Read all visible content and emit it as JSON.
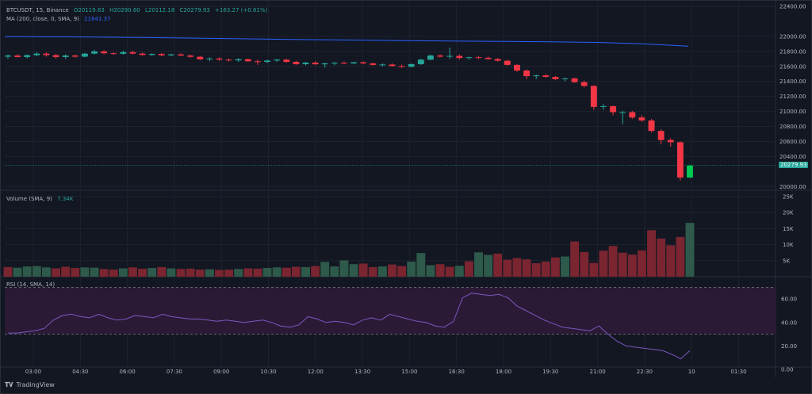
{
  "header": {
    "symbol": "BTCUSDT, 15, Binance",
    "o": "O20119.83",
    "h": "H20290.60",
    "l": "L20112.18",
    "c": "C20279.93",
    "chg": "+163.27 (+0.81%)",
    "ma_label": "MA (200, close, 0, SMA, 9)",
    "ma_value": "21841.37"
  },
  "volume_legend": {
    "label": "Volume (SMA, 9)",
    "value": "7.34K"
  },
  "rsi_legend": {
    "label": "RSI (14, SMA, 14)"
  },
  "last_price_label": "20279.93",
  "brand": "TradingView",
  "colors": {
    "bg": "#131722",
    "up": "#26a69a",
    "down": "#f23645",
    "up_bright": "#00c853",
    "ma": "#2962ff",
    "grid": "#1e222d",
    "axis_text": "#b2b5be",
    "vol_up": "#2e5a4b",
    "vol_down": "#7a2530",
    "rsi": "#7e57c2",
    "rsi_band": "#2a1a35"
  },
  "chart_data": [
    {
      "type": "candlestick",
      "title": "BTCUSDT, 15, Binance",
      "ylim": [
        19950,
        22400
      ],
      "price_ticks": [
        "22400.00",
        "22000.00",
        "21800.00",
        "21600.00",
        "21400.00",
        "21200.00",
        "21000.00",
        "20800.00",
        "20600.00",
        "20400.00",
        "20279.93",
        "20000.00"
      ],
      "time_ticks": [
        "03:00",
        "04:30",
        "06:00",
        "07:30",
        "09:00",
        "10:30",
        "12:00",
        "13:30",
        "15:00",
        "16:30",
        "18:00",
        "19:30",
        "21:00",
        "22:30",
        "10",
        "01:30"
      ],
      "ma_series": [
        21998,
        21995,
        21990,
        21985,
        21978,
        21970,
        21962,
        21955,
        21948,
        21942,
        21936,
        21932,
        21928,
        21920,
        21900,
        21870
      ],
      "candles": [
        [
          21730,
          21760,
          21700,
          21745
        ],
        [
          21745,
          21765,
          21720,
          21725
        ],
        [
          21725,
          21760,
          21705,
          21750
        ],
        [
          21750,
          21790,
          21735,
          21770
        ],
        [
          21770,
          21790,
          21730,
          21750
        ],
        [
          21750,
          21770,
          21705,
          21725
        ],
        [
          21725,
          21760,
          21700,
          21745
        ],
        [
          21745,
          21760,
          21715,
          21730
        ],
        [
          21730,
          21780,
          21720,
          21770
        ],
        [
          21770,
          21820,
          21760,
          21800
        ],
        [
          21800,
          21815,
          21760,
          21775
        ],
        [
          21775,
          21790,
          21755,
          21768
        ],
        [
          21768,
          21810,
          21755,
          21790
        ],
        [
          21790,
          21805,
          21760,
          21770
        ],
        [
          21770,
          21785,
          21745,
          21752
        ],
        [
          21752,
          21775,
          21740,
          21765
        ],
        [
          21765,
          21780,
          21735,
          21748
        ],
        [
          21748,
          21770,
          21735,
          21760
        ],
        [
          21760,
          21775,
          21735,
          21745
        ],
        [
          21745,
          21760,
          21715,
          21728
        ],
        [
          21728,
          21740,
          21685,
          21695
        ],
        [
          21695,
          21720,
          21670,
          21705
        ],
        [
          21705,
          21720,
          21675,
          21690
        ],
        [
          21690,
          21705,
          21665,
          21680
        ],
        [
          21680,
          21710,
          21660,
          21695
        ],
        [
          21695,
          21705,
          21660,
          21668
        ],
        [
          21668,
          21690,
          21620,
          21660
        ],
        [
          21660,
          21690,
          21645,
          21678
        ],
        [
          21678,
          21700,
          21660,
          21690
        ],
        [
          21690,
          21700,
          21650,
          21660
        ],
        [
          21660,
          21675,
          21620,
          21630
        ],
        [
          21630,
          21660,
          21615,
          21650
        ],
        [
          21650,
          21670,
          21620,
          21628
        ],
        [
          21628,
          21650,
          21585,
          21640
        ],
        [
          21640,
          21660,
          21615,
          21648
        ],
        [
          21648,
          21665,
          21630,
          21640
        ],
        [
          21640,
          21660,
          21630,
          21655
        ],
        [
          21655,
          21665,
          21630,
          21640
        ],
        [
          21640,
          21650,
          21610,
          21620
        ],
        [
          21620,
          21640,
          21600,
          21625
        ],
        [
          21625,
          21640,
          21595,
          21605
        ],
        [
          21605,
          21625,
          21580,
          21596
        ],
        [
          21596,
          21640,
          21585,
          21630
        ],
        [
          21630,
          21700,
          21620,
          21690
        ],
        [
          21690,
          21760,
          21680,
          21745
        ],
        [
          21745,
          21760,
          21720,
          21730
        ],
        [
          21730,
          21850,
          21700,
          21740
        ],
        [
          21740,
          21760,
          21690,
          21712
        ],
        [
          21712,
          21730,
          21690,
          21722
        ],
        [
          21722,
          21740,
          21700,
          21715
        ],
        [
          21715,
          21730,
          21690,
          21698
        ],
        [
          21698,
          21712,
          21665,
          21675
        ],
        [
          21675,
          21690,
          21610,
          21620
        ],
        [
          21620,
          21630,
          21530,
          21545
        ],
        [
          21545,
          21560,
          21430,
          21470
        ],
        [
          21470,
          21490,
          21430,
          21480
        ],
        [
          21480,
          21495,
          21450,
          21460
        ],
        [
          21460,
          21470,
          21420,
          21430
        ],
        [
          21430,
          21450,
          21400,
          21440
        ],
        [
          21440,
          21450,
          21380,
          21390
        ],
        [
          21390,
          21410,
          21320,
          21340
        ],
        [
          21340,
          21350,
          21020,
          21060
        ],
        [
          21060,
          21100,
          21020,
          21070
        ],
        [
          21070,
          21080,
          20950,
          20990
        ],
        [
          20990,
          21010,
          20830,
          20990
        ],
        [
          20990,
          21010,
          20900,
          20920
        ],
        [
          20920,
          20950,
          20860,
          20880
        ],
        [
          20880,
          20900,
          20720,
          20740
        ],
        [
          20740,
          20760,
          20560,
          20620
        ],
        [
          20620,
          20640,
          20530,
          20590
        ],
        [
          20590,
          20600,
          20080,
          20120
        ],
        [
          20120,
          20290,
          20112,
          20280
        ]
      ]
    },
    {
      "type": "bar",
      "title": "Volume (SMA, 9)",
      "ylim": [
        0,
        26000
      ],
      "tick_labels": [
        "25K",
        "20K",
        "15K",
        "10K",
        "5K"
      ],
      "values": [
        3000,
        2800,
        3200,
        3300,
        2900,
        2600,
        3100,
        2700,
        2900,
        2800,
        2400,
        2200,
        2600,
        2900,
        2500,
        2700,
        3000,
        2600,
        2400,
        2500,
        2200,
        2300,
        2100,
        2200,
        2400,
        2600,
        2500,
        2700,
        2900,
        2800,
        3100,
        3000,
        3300,
        4600,
        3200,
        5100,
        3900,
        4100,
        3000,
        3200,
        3800,
        3300,
        4700,
        7400,
        3600,
        3900,
        3100,
        3400,
        4800,
        7600,
        6800,
        7200,
        5300,
        5800,
        5400,
        4200,
        4700,
        6000,
        6300,
        11000,
        7700,
        4300,
        8100,
        9600,
        7500,
        6900,
        8200,
        14500,
        11900,
        9800,
        12400,
        16800
      ],
      "up": [
        false,
        true,
        true,
        true,
        true,
        false,
        false,
        false,
        true,
        true,
        false,
        false,
        true,
        false,
        false,
        true,
        false,
        true,
        false,
        false,
        false,
        true,
        false,
        false,
        true,
        false,
        false,
        true,
        true,
        false,
        false,
        true,
        false,
        true,
        true,
        true,
        true,
        false,
        false,
        true,
        false,
        false,
        true,
        true,
        true,
        false,
        false,
        true,
        false,
        true,
        true,
        false,
        false,
        false,
        false,
        false,
        false,
        false,
        true,
        false,
        false,
        false,
        false,
        false,
        false,
        false,
        false,
        false,
        false,
        false,
        false,
        true
      ]
    },
    {
      "type": "line",
      "title": "RSI (14, SMA, 14)",
      "ylim": [
        0,
        75
      ],
      "tick_labels": [
        "60.00",
        "40.00",
        "20.00",
        "0.00"
      ],
      "band": [
        30,
        70
      ],
      "values": [
        31,
        31,
        32,
        33,
        35,
        42,
        46,
        47,
        45,
        44,
        47,
        44,
        42,
        43,
        46,
        45,
        44,
        47,
        45,
        44,
        43,
        43,
        42,
        41,
        42,
        41,
        40,
        41,
        42,
        40,
        37,
        36,
        38,
        45,
        43,
        40,
        41,
        40,
        38,
        42,
        44,
        42,
        47,
        45,
        43,
        41,
        40,
        37,
        36,
        41,
        61,
        65,
        64,
        63,
        64,
        61,
        54,
        50,
        46,
        42,
        39,
        36,
        35,
        34,
        33,
        37,
        30,
        24,
        20,
        19,
        18,
        17,
        16,
        13,
        9,
        16
      ]
    }
  ]
}
